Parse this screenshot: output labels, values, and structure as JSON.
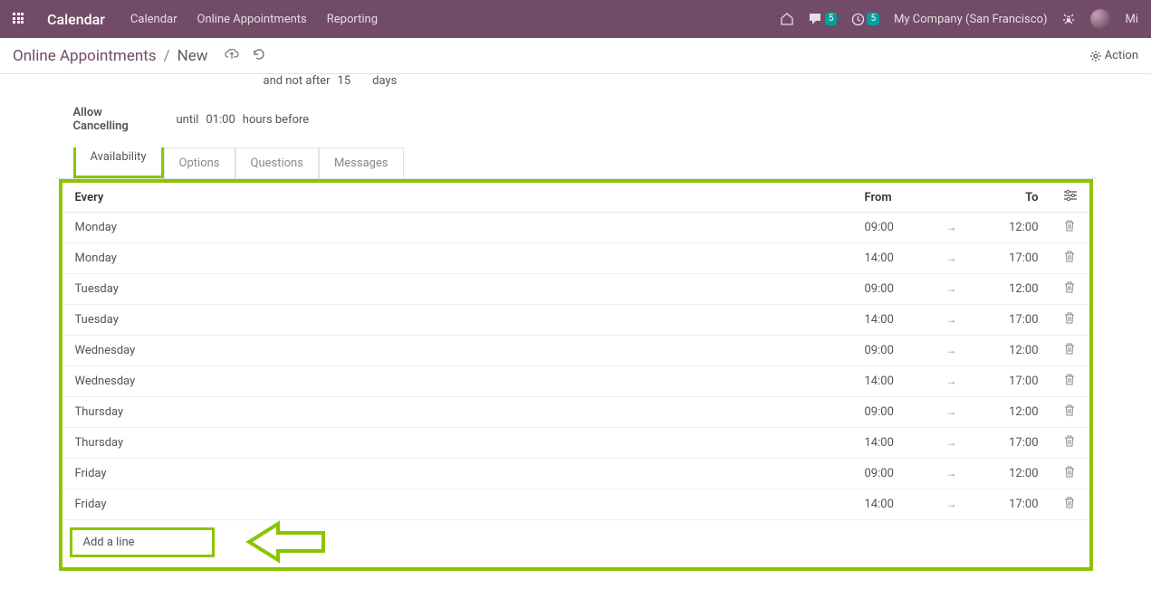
{
  "topbar": {
    "brand": "Calendar",
    "nav": [
      "Calendar",
      "Online Appointments",
      "Reporting"
    ],
    "msg_badge": "5",
    "activity_badge": "5",
    "company": "My Company (San Francisco)",
    "user_short": "Mi"
  },
  "breadcrumb": {
    "crumb1": "Online Appointments",
    "sep": "/",
    "crumb2": "New",
    "action_label": "Action"
  },
  "form": {
    "not_after_prefix": "and not after",
    "not_after_value": "15",
    "not_after_unit": "days",
    "cancel_label": "Allow Cancelling",
    "cancel_prefix": "until",
    "cancel_value": "01:00",
    "cancel_suffix": "hours before"
  },
  "tabs": [
    "Availability",
    "Options",
    "Questions",
    "Messages"
  ],
  "table": {
    "headers": {
      "every": "Every",
      "from": "From",
      "to": "To"
    },
    "rows": [
      {
        "day": "Monday",
        "from": "09:00",
        "to": "12:00"
      },
      {
        "day": "Monday",
        "from": "14:00",
        "to": "17:00"
      },
      {
        "day": "Tuesday",
        "from": "09:00",
        "to": "12:00"
      },
      {
        "day": "Tuesday",
        "from": "14:00",
        "to": "17:00"
      },
      {
        "day": "Wednesday",
        "from": "09:00",
        "to": "12:00"
      },
      {
        "day": "Wednesday",
        "from": "14:00",
        "to": "17:00"
      },
      {
        "day": "Thursday",
        "from": "09:00",
        "to": "12:00"
      },
      {
        "day": "Thursday",
        "from": "14:00",
        "to": "17:00"
      },
      {
        "day": "Friday",
        "from": "09:00",
        "to": "12:00"
      },
      {
        "day": "Friday",
        "from": "14:00",
        "to": "17:00"
      }
    ],
    "add_line": "Add a line"
  }
}
